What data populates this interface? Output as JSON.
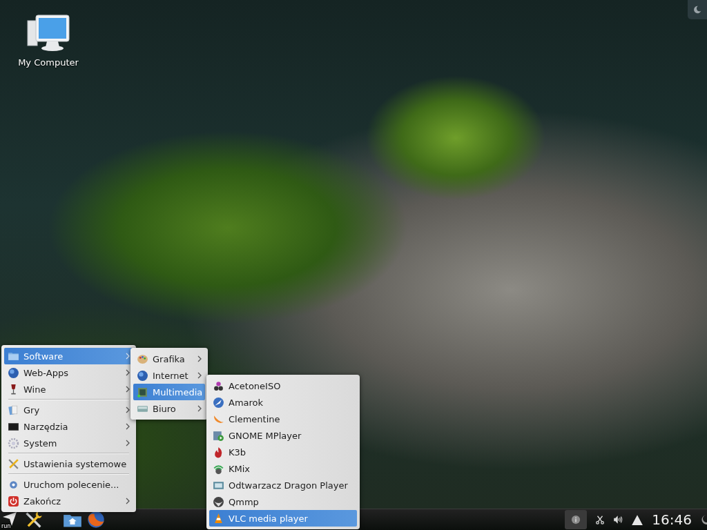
{
  "desktop_icons": [
    {
      "label": "My Computer"
    }
  ],
  "main_menu": {
    "sections": [
      [
        {
          "label": "Software",
          "submenu": true,
          "selected": true
        },
        {
          "label": "Web-Apps",
          "submenu": true,
          "selected": false
        },
        {
          "label": "Wine",
          "submenu": true,
          "selected": false
        }
      ],
      [
        {
          "label": "Gry",
          "submenu": true,
          "selected": false
        },
        {
          "label": "Narzędzia",
          "submenu": true,
          "selected": false
        },
        {
          "label": "System",
          "submenu": true,
          "selected": false
        }
      ],
      [
        {
          "label": "Ustawienia systemowe",
          "submenu": false,
          "selected": false
        }
      ],
      [
        {
          "label": "Uruchom polecenie...",
          "submenu": false,
          "selected": false
        },
        {
          "label": "Zakończ",
          "submenu": true,
          "selected": false
        }
      ]
    ]
  },
  "software_menu": {
    "items": [
      {
        "label": "Grafika",
        "submenu": true,
        "selected": false
      },
      {
        "label": "Internet",
        "submenu": true,
        "selected": false
      },
      {
        "label": "Multimedia",
        "submenu": true,
        "selected": true
      },
      {
        "label": "Biuro",
        "submenu": true,
        "selected": false
      }
    ]
  },
  "multimedia_menu": {
    "items": [
      {
        "label": "AcetoneISO",
        "selected": false
      },
      {
        "label": "Amarok",
        "selected": false
      },
      {
        "label": "Clementine",
        "selected": false
      },
      {
        "label": "GNOME MPlayer",
        "selected": false
      },
      {
        "label": "K3b",
        "selected": false
      },
      {
        "label": "KMix",
        "selected": false
      },
      {
        "label": "Odtwarzacz Dragon Player",
        "selected": false
      },
      {
        "label": "Qmmp",
        "selected": false
      },
      {
        "label": "VLC media player",
        "selected": true
      }
    ]
  },
  "taskbar": {
    "launcher_label": "run",
    "clock": "16:46"
  }
}
